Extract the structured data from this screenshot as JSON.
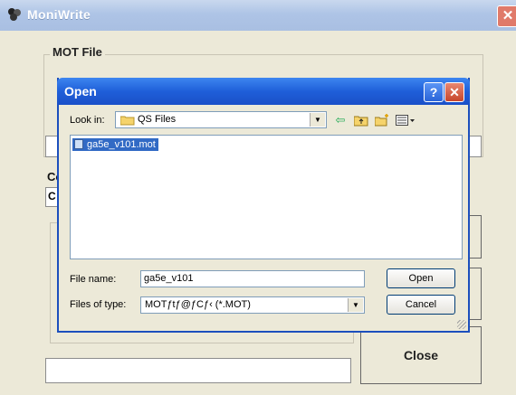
{
  "app": {
    "title": "MoniWrite",
    "close_glyph": "✕",
    "icon": "app-logo-icon"
  },
  "main": {
    "mot_file_legend": "MOT File",
    "com_label_partial": "Co",
    "com_value_partial": "C",
    "close_button": "Close"
  },
  "dialog": {
    "title": "Open",
    "help_glyph": "?",
    "close_glyph": "✕",
    "look_in_label": "Look in:",
    "look_in_value": "QS Files",
    "toolbar_icons": [
      "back-arrow-icon",
      "up-folder-icon",
      "new-folder-icon",
      "view-menu-icon"
    ],
    "files": [
      {
        "name": "ga5e_v101.mot",
        "selected": true
      }
    ],
    "file_name_label": "File name:",
    "file_name_value": "ga5e_v101",
    "files_of_type_label": "Files of type:",
    "files_of_type_value": "MOTƒtƒ@ƒCƒ‹ (*.MOT)",
    "open_button": "Open",
    "cancel_button": "Cancel"
  },
  "colors": {
    "dialog_title_blue": "#1f5fd9",
    "selection_blue": "#316ac5",
    "window_bg": "#ece9d8"
  }
}
